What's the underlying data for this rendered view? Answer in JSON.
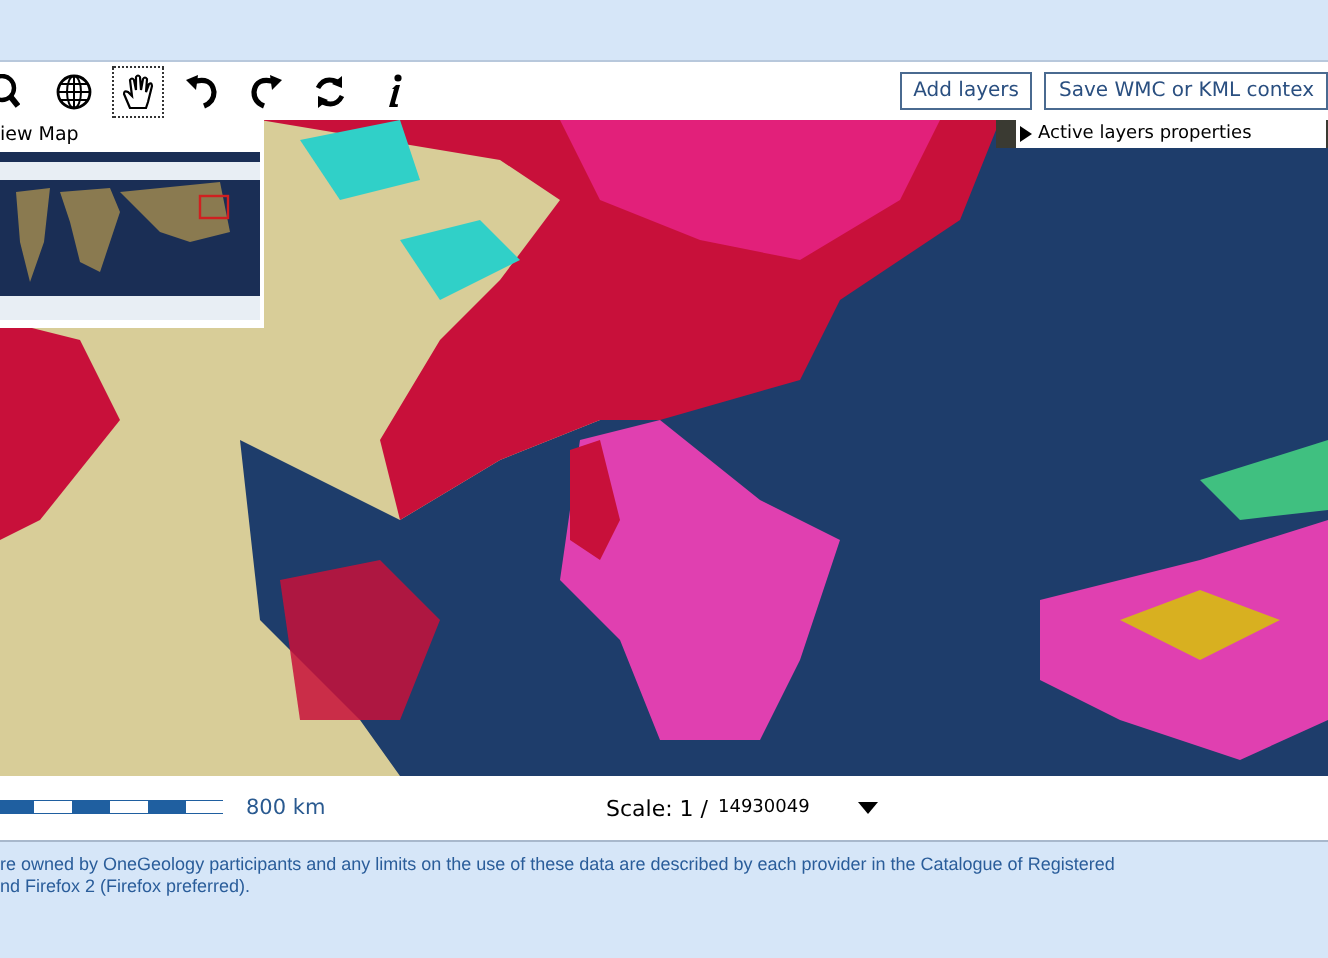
{
  "toolbar": {
    "tools": [
      {
        "kind": "zoom",
        "selected": false
      },
      {
        "kind": "globe",
        "selected": false
      },
      {
        "kind": "pan",
        "selected": true
      },
      {
        "kind": "undo",
        "selected": false
      },
      {
        "kind": "redo",
        "selected": false
      },
      {
        "kind": "refresh",
        "selected": false
      },
      {
        "kind": "info",
        "selected": false
      }
    ],
    "buttons": [
      "Add layers",
      "Save WMC or KML contex"
    ]
  },
  "overview": {
    "title": "iew Map"
  },
  "active_layers": {
    "label": "Active layers properties"
  },
  "scale_bar": {
    "label": "800 km"
  },
  "scale": {
    "label": "Scale: 1 /",
    "value": "14930049"
  },
  "footer": {
    "lines": [
      "re owned by OneGeology participants and any limits on the use of these data are described by each provider in the Catalogue of Registered",
      "nd Firefox 2 (Firefox preferred)."
    ]
  }
}
